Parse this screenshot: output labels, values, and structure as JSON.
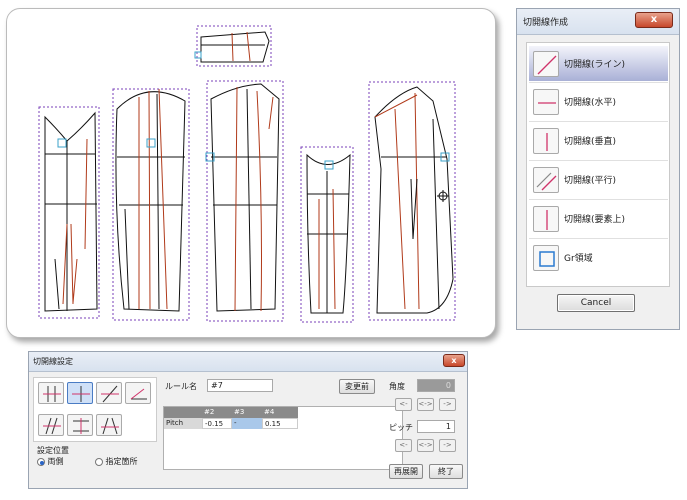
{
  "right_dialog": {
    "title": "切開線作成",
    "close": "x",
    "items": [
      {
        "label": "切開線(ライン)",
        "active": true
      },
      {
        "label": "切開線(水平)",
        "active": false
      },
      {
        "label": "切開線(垂直)",
        "active": false
      },
      {
        "label": "切開線(平行)",
        "active": false
      },
      {
        "label": "切開線(要素上)",
        "active": false
      },
      {
        "label": "Gr領域",
        "active": false
      }
    ],
    "cancel": "Cancel"
  },
  "bottom_dialog": {
    "title": "切開線設定",
    "close": "x",
    "rule_label": "ルール名",
    "rule_value": "#7",
    "change_button": "変更前",
    "position_label": "設定位置",
    "radio_both": "両側",
    "radio_specified": "指定箇所",
    "angle_label": "角度",
    "angle_value": "0",
    "pitch_label": "ピッチ",
    "pitch_value": "1",
    "arrows": [
      "<-",
      "<->",
      "->"
    ],
    "reexpand_button": "再展開",
    "finish_button": "終了",
    "table": {
      "headers": [
        "",
        "#2",
        "#3",
        "#4"
      ],
      "row_label": "Pitch",
      "values": [
        "-0.15",
        "-",
        "0.15"
      ]
    }
  },
  "colors": {
    "cut_line": "#b03a1a",
    "selection": "#7a40b8",
    "accent": "#2a64c5"
  }
}
